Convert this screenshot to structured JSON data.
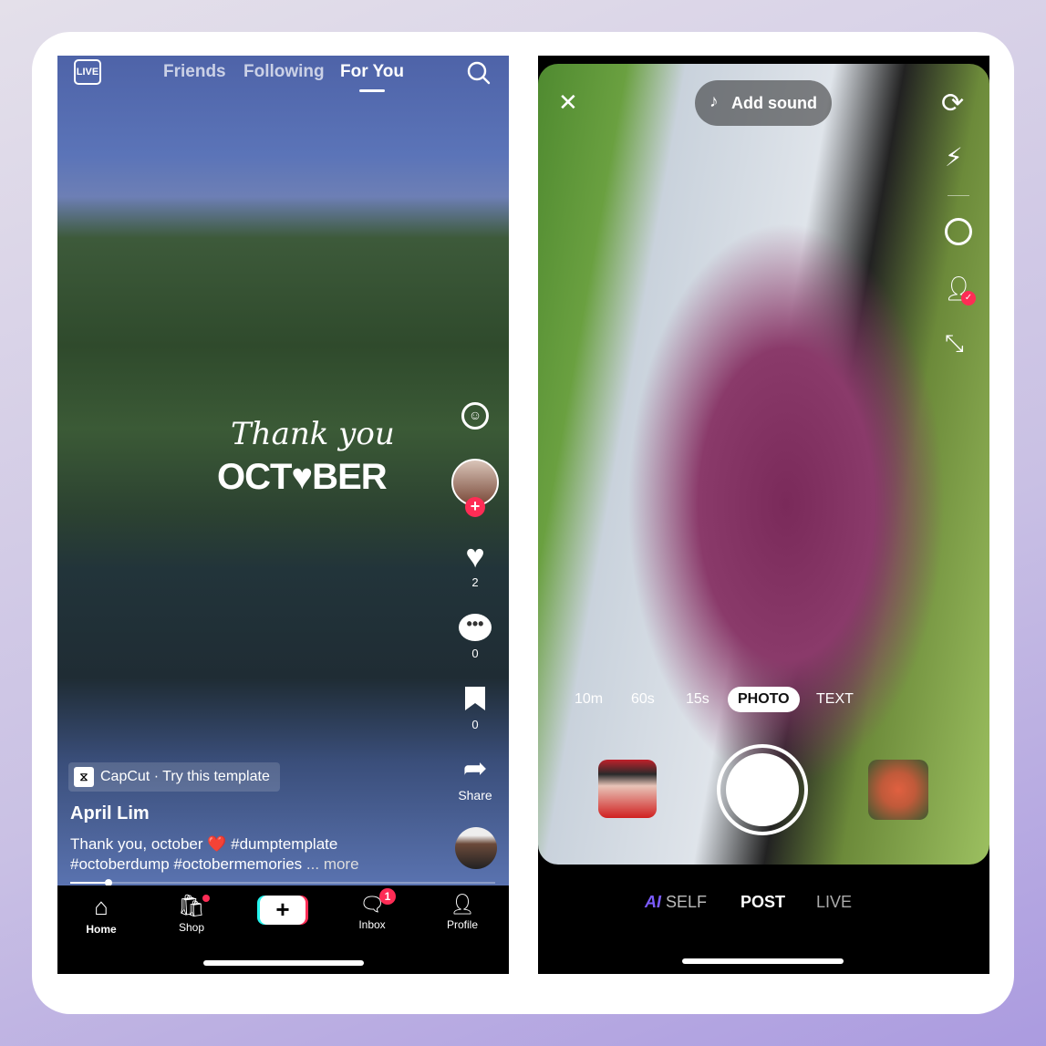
{
  "feed": {
    "live_label": "LIVE",
    "tabs": [
      {
        "label": "Friends"
      },
      {
        "label": "Following"
      },
      {
        "label": "For You",
        "active": true
      }
    ],
    "overlay_script": "Thank you",
    "overlay_title": "OCT♥BER",
    "actions": {
      "likes": "2",
      "comments": "0",
      "saves": "0",
      "share_label": "Share"
    },
    "capcut_label": "CapCut · Try this template",
    "author": "April Lim",
    "caption_line1": "Thank you, october ❤️ #dumptemplate",
    "caption_line2": "#octoberdump #octobermemories",
    "more_label": "... more",
    "progress": 0.09,
    "bottom_nav": [
      {
        "label": "Home",
        "icon": "home-icon"
      },
      {
        "label": "Shop",
        "icon": "shopping-bag-icon"
      },
      {
        "label": "",
        "icon": "plus-icon"
      },
      {
        "label": "Inbox",
        "icon": "inbox-icon",
        "badge": "1"
      },
      {
        "label": "Profile",
        "icon": "profile-icon"
      }
    ],
    "accent": "#fe2c55"
  },
  "camera": {
    "add_sound": "Add sound",
    "modes": [
      "10m",
      "60s",
      "15s",
      "PHOTO",
      "TEXT"
    ],
    "selected_mode": "PHOTO",
    "bottom_modes": {
      "ai": "AI",
      "self": "SELF",
      "post": "POST",
      "live": "LIVE"
    },
    "ai_color": "#7b5cff"
  }
}
